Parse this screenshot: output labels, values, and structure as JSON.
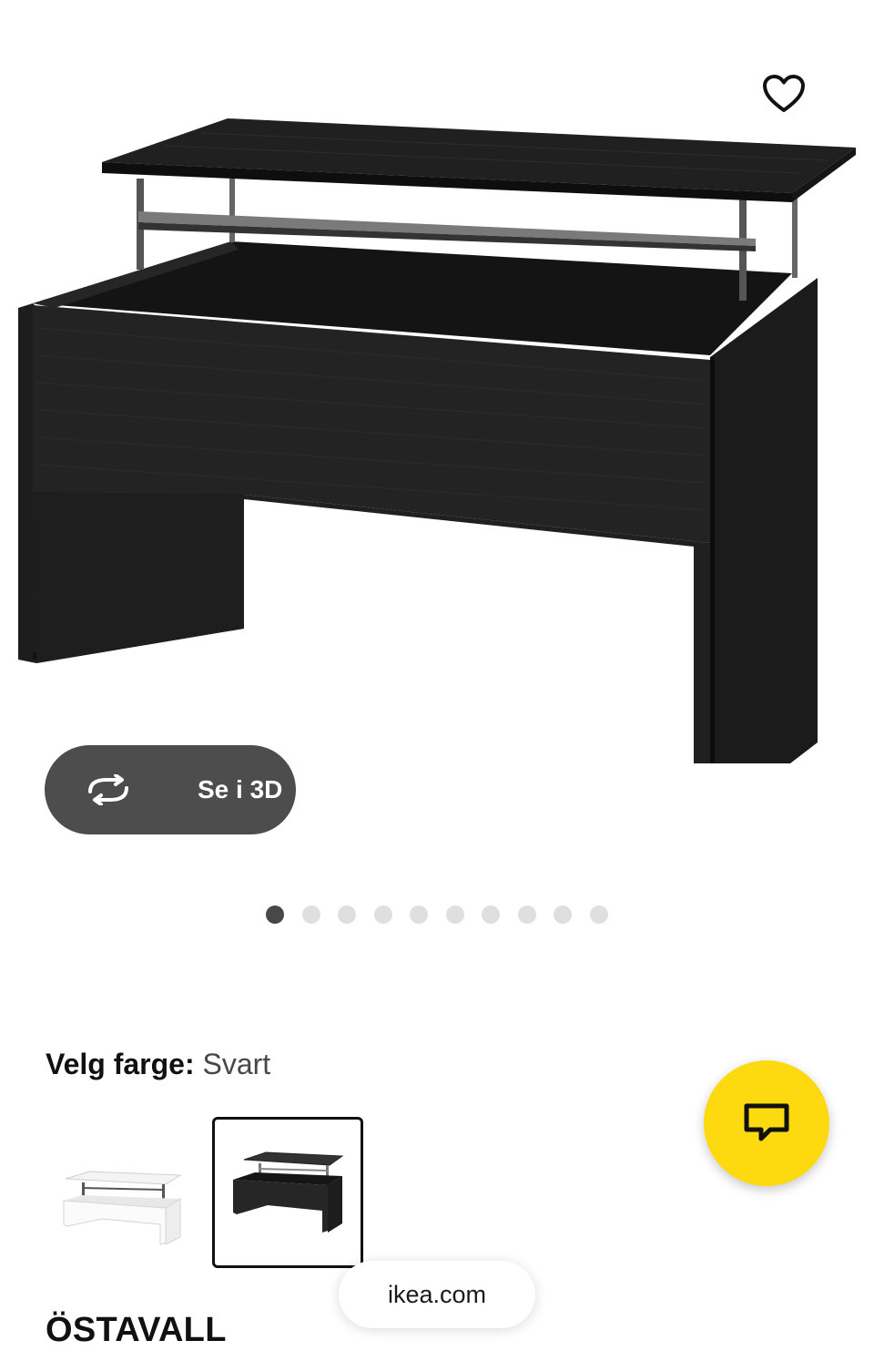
{
  "media": {
    "three_d_button_label": "Se i 3D",
    "favourite_icon": "heart-icon",
    "three_d_icon": "rotate-3d-icon",
    "carousel": {
      "total": 10,
      "active_index": 0
    }
  },
  "color_selector": {
    "label": "Velg farge:",
    "selected_value": "Svart",
    "options": [
      {
        "name": "Hvit",
        "selected": false
      },
      {
        "name": "Svart",
        "selected": true
      }
    ]
  },
  "chat": {
    "icon": "chat-bubble-icon",
    "color": "#fdd90f"
  },
  "browser": {
    "url": "ikea.com"
  },
  "product": {
    "name": "ÖSTAVALL"
  }
}
